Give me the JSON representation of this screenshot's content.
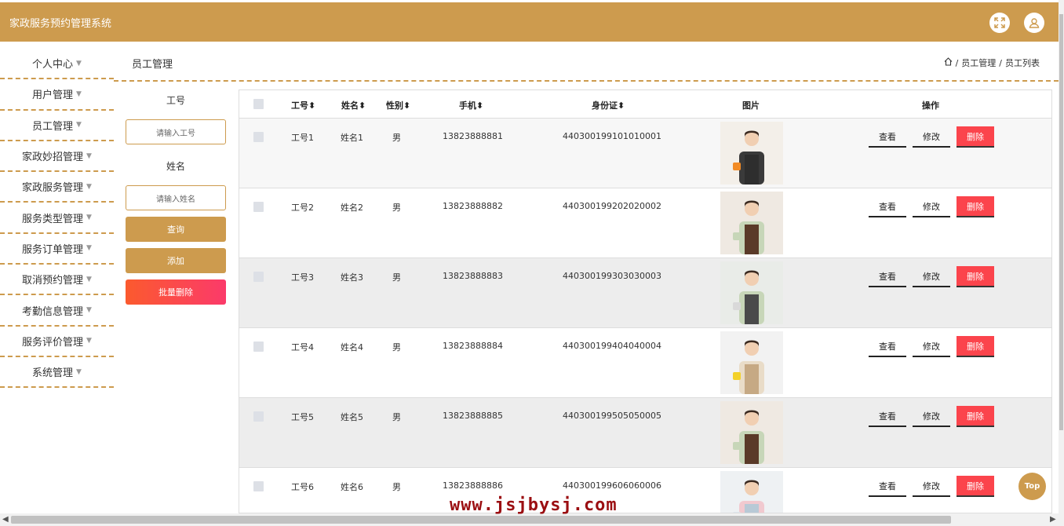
{
  "app": {
    "title": "家政服务预约管理系统"
  },
  "header_icons": [
    "fullscreen-icon",
    "user-icon"
  ],
  "sidebar": {
    "items": [
      {
        "label": "个人中心"
      },
      {
        "label": "用户管理"
      },
      {
        "label": "员工管理"
      },
      {
        "label": "家政妙招管理"
      },
      {
        "label": "家政服务管理"
      },
      {
        "label": "服务类型管理"
      },
      {
        "label": "服务订单管理"
      },
      {
        "label": "取消预约管理"
      },
      {
        "label": "考勤信息管理"
      },
      {
        "label": "服务评价管理"
      },
      {
        "label": "系统管理"
      }
    ]
  },
  "page": {
    "title": "员工管理",
    "breadcrumb": [
      "员工管理",
      "员工列表"
    ]
  },
  "search": {
    "id_label": "工号",
    "id_placeholder": "请输入工号",
    "name_label": "姓名",
    "name_placeholder": "请输入姓名",
    "query_label": "查询",
    "add_label": "添加",
    "batch_delete_label": "批量删除"
  },
  "table": {
    "headers": {
      "id": "工号",
      "name": "姓名",
      "gender": "性别",
      "phone": "手机",
      "idcard": "身份证",
      "photo": "图片",
      "actions": "操作"
    },
    "action_labels": {
      "view": "查看",
      "edit": "修改",
      "delete": "删除"
    },
    "rows": [
      {
        "id": "工号1",
        "name": "姓名1",
        "gender": "男",
        "phone": "13823888881",
        "idcard": "440300199101010001"
      },
      {
        "id": "工号2",
        "name": "姓名2",
        "gender": "男",
        "phone": "13823888882",
        "idcard": "440300199202020002"
      },
      {
        "id": "工号3",
        "name": "姓名3",
        "gender": "男",
        "phone": "13823888883",
        "idcard": "440300199303030003"
      },
      {
        "id": "工号4",
        "name": "姓名4",
        "gender": "男",
        "phone": "13823888884",
        "idcard": "440300199404040004"
      },
      {
        "id": "工号5",
        "name": "姓名5",
        "gender": "男",
        "phone": "13823888885",
        "idcard": "440300199505050005"
      },
      {
        "id": "工号6",
        "name": "姓名6",
        "gender": "男",
        "phone": "13823888886",
        "idcard": "440300199606060006"
      }
    ]
  },
  "top_button": "Top",
  "watermark": "www.jsjbysj.com",
  "colors": {
    "brand": "#cd9b4e",
    "danger": "#fb444c"
  }
}
